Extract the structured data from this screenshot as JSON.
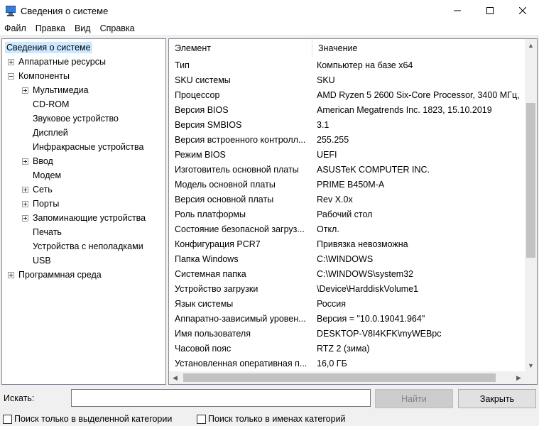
{
  "window": {
    "title": "Сведения о системе",
    "controls": {
      "minimize": "—",
      "maximize": "☐",
      "close": "✕"
    }
  },
  "menu": [
    "Файл",
    "Правка",
    "Вид",
    "Справка"
  ],
  "tree": [
    {
      "label": "Сведения о системе",
      "level": 0,
      "expander": "none",
      "selected": true
    },
    {
      "label": "Аппаратные ресурсы",
      "level": 1,
      "expander": "plus"
    },
    {
      "label": "Компоненты",
      "level": 1,
      "expander": "minus"
    },
    {
      "label": "Мультимедиа",
      "level": 2,
      "expander": "plus"
    },
    {
      "label": "CD-ROM",
      "level": 2,
      "expander": "none"
    },
    {
      "label": "Звуковое устройство",
      "level": 2,
      "expander": "none"
    },
    {
      "label": "Дисплей",
      "level": 2,
      "expander": "none"
    },
    {
      "label": "Инфракрасные устройства",
      "level": 2,
      "expander": "none"
    },
    {
      "label": "Ввод",
      "level": 2,
      "expander": "plus"
    },
    {
      "label": "Модем",
      "level": 2,
      "expander": "none"
    },
    {
      "label": "Сеть",
      "level": 2,
      "expander": "plus"
    },
    {
      "label": "Порты",
      "level": 2,
      "expander": "plus"
    },
    {
      "label": "Запоминающие устройства",
      "level": 2,
      "expander": "plus"
    },
    {
      "label": "Печать",
      "level": 2,
      "expander": "none"
    },
    {
      "label": "Устройства с неполадками",
      "level": 2,
      "expander": "none"
    },
    {
      "label": "USB",
      "level": 2,
      "expander": "none"
    },
    {
      "label": "Программная среда",
      "level": 1,
      "expander": "plus"
    }
  ],
  "list": {
    "headers": {
      "element": "Элемент",
      "value": "Значение"
    },
    "rows": [
      {
        "element": "Тип",
        "value": "Компьютер на базе x64"
      },
      {
        "element": "SKU системы",
        "value": "SKU"
      },
      {
        "element": "Процессор",
        "value": "AMD Ryzen 5 2600 Six-Core Processor, 3400 МГц,"
      },
      {
        "element": "Версия BIOS",
        "value": "American Megatrends Inc. 1823, 15.10.2019"
      },
      {
        "element": "Версия SMBIOS",
        "value": "3.1"
      },
      {
        "element": "Версия встроенного контролл...",
        "value": "255.255"
      },
      {
        "element": "Режим BIOS",
        "value": "UEFI"
      },
      {
        "element": "Изготовитель основной платы",
        "value": "ASUSTeK COMPUTER INC."
      },
      {
        "element": "Модель основной платы",
        "value": "PRIME B450M-A"
      },
      {
        "element": "Версия основной платы",
        "value": "Rev X.0x"
      },
      {
        "element": "Роль платформы",
        "value": "Рабочий стол"
      },
      {
        "element": "Состояние безопасной загруз...",
        "value": "Откл."
      },
      {
        "element": "Конфигурация PCR7",
        "value": "Привязка невозможна"
      },
      {
        "element": "Папка Windows",
        "value": "C:\\WINDOWS"
      },
      {
        "element": "Системная папка",
        "value": "C:\\WINDOWS\\system32"
      },
      {
        "element": "Устройство загрузки",
        "value": "\\Device\\HarddiskVolume1"
      },
      {
        "element": "Язык системы",
        "value": "Россия"
      },
      {
        "element": "Аппаратно-зависимый уровен...",
        "value": "Версия = \"10.0.19041.964\""
      },
      {
        "element": "Имя пользователя",
        "value": "DESKTOP-V8I4KFK\\myWEBpc"
      },
      {
        "element": "Часовой пояс",
        "value": "RTZ 2 (зима)"
      },
      {
        "element": "Установленная оперативная п...",
        "value": "16,0 ГБ"
      }
    ]
  },
  "search": {
    "label": "Искать:",
    "value": "",
    "find_button": "Найти",
    "close_button": "Закрыть",
    "checkbox_selected_category": "Поиск только в выделенной категории",
    "checkbox_category_names": "Поиск только в именах категорий"
  },
  "scroll": {
    "up_arrow": "▲",
    "down_arrow": "▼",
    "left_arrow": "◀",
    "right_arrow": "▶"
  }
}
